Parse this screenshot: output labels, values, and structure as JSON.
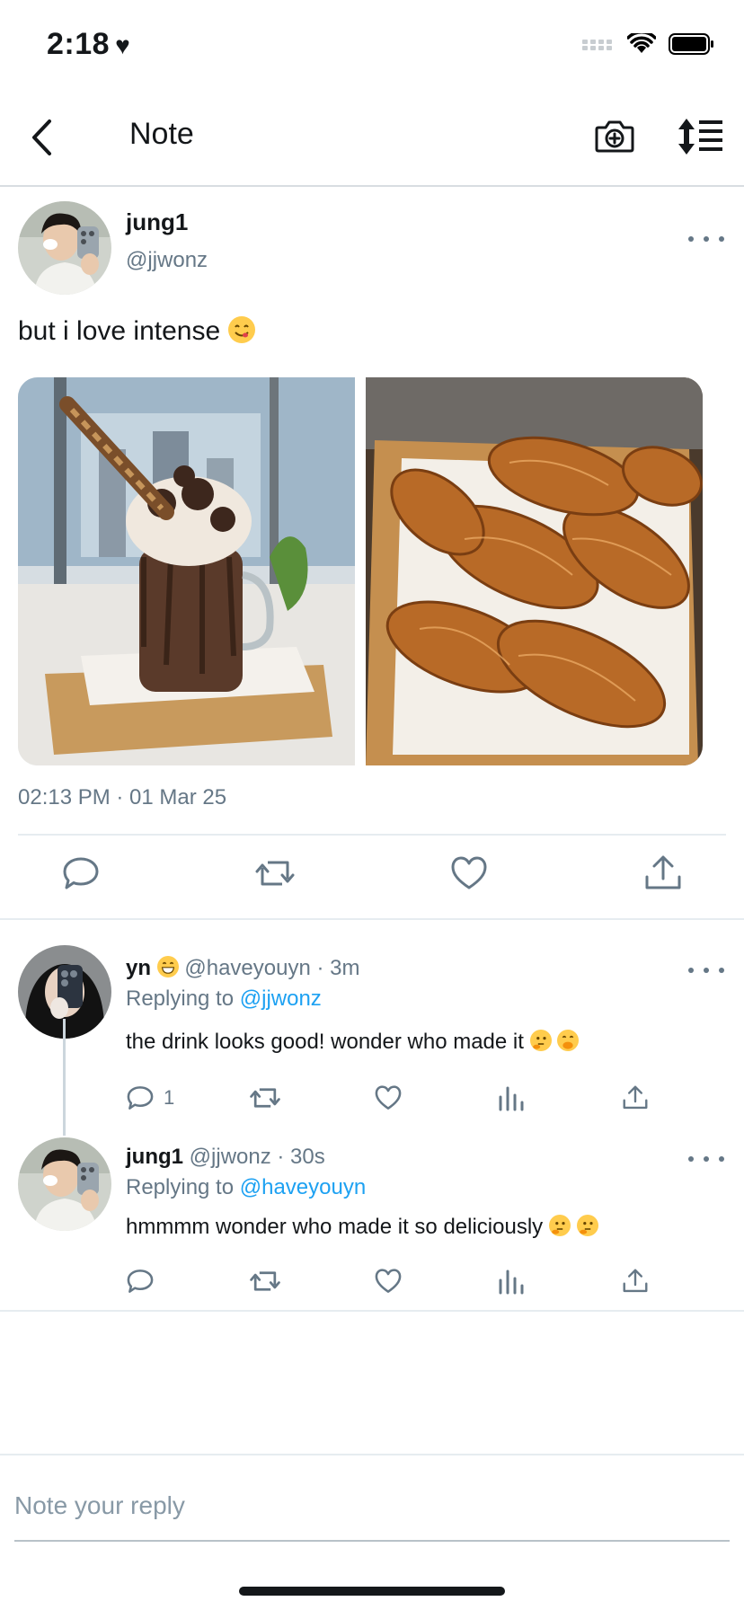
{
  "status_bar": {
    "time": "2:18",
    "heart_icon": "heart-icon",
    "icons": [
      "cellular-dots-icon",
      "wifi-icon",
      "battery-icon"
    ]
  },
  "nav": {
    "title": "Note",
    "back_icon": "chevron-left-icon",
    "camera_icon": "camera-plus-icon",
    "sort_icon": "sort-icon"
  },
  "main_post": {
    "name": "jung1",
    "handle": "@jjwonz",
    "text": "but i love intense",
    "emoji": "yum-face-emoji",
    "photos": [
      {
        "description": "chocolate milkshake"
      },
      {
        "description": "croissants"
      }
    ],
    "timestamp": "02:13 PM · 01 Mar 25",
    "actions": [
      "reply-icon",
      "retweet-icon",
      "like-icon",
      "share-icon"
    ]
  },
  "replies": [
    {
      "name": "yn",
      "handle_meta": "@haveyouyn · 3m",
      "replying_label": "Replying to ",
      "replying_to": "@jjwonz",
      "text": "the drink looks good! wonder who made it",
      "reply_count": "1"
    },
    {
      "name": "jung1",
      "handle_meta": "@jjwonz · 30s",
      "replying_label": "Replying to ",
      "replying_to": "@haveyouyn",
      "text": "hmmmm wonder who made it so deliciously",
      "reply_count": ""
    }
  ],
  "compose": {
    "placeholder": "Note your reply",
    "value": ""
  },
  "colors": {
    "accent": "#1da1f2",
    "muted": "#657786",
    "text": "#14171a"
  }
}
